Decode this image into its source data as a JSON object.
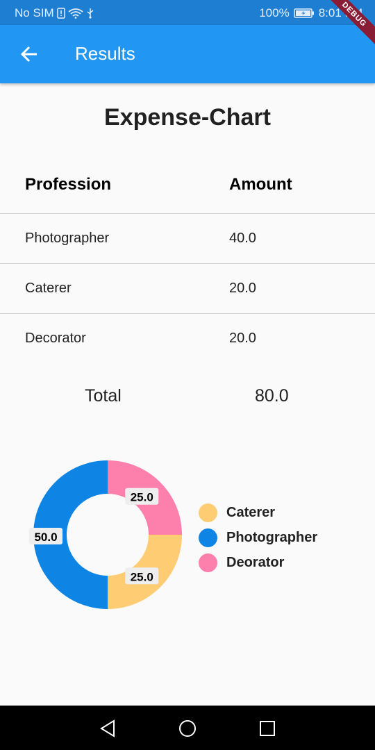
{
  "status_bar": {
    "carrier": "No SIM",
    "battery": "100%",
    "time": "8:01 PM",
    "debug_label": "DEBUG"
  },
  "app_bar": {
    "title": "Results",
    "back_icon": "arrow-back-icon",
    "background": "#2196f3"
  },
  "heading": "Expense-Chart",
  "table": {
    "headers": [
      "Profession",
      "Amount"
    ],
    "rows": [
      [
        "Photographer",
        "40.0"
      ],
      [
        "Caterer",
        "20.0"
      ],
      [
        "Decorator",
        "20.0"
      ]
    ]
  },
  "total": {
    "label": "Total",
    "value": "80.0"
  },
  "chart_data": {
    "type": "pie",
    "donut": true,
    "categories": [
      "Caterer",
      "Photographer",
      "Deorator"
    ],
    "values": [
      25.0,
      50.0,
      25.0
    ],
    "labels": [
      "25.0",
      "50.0",
      "25.0"
    ],
    "colors": [
      "#fdcc73",
      "#0e84e4",
      "#fd7fac"
    ],
    "legend_position": "right"
  },
  "nav_bar": {
    "icons": [
      "back-triangle-icon",
      "home-circle-icon",
      "recents-square-icon"
    ]
  }
}
